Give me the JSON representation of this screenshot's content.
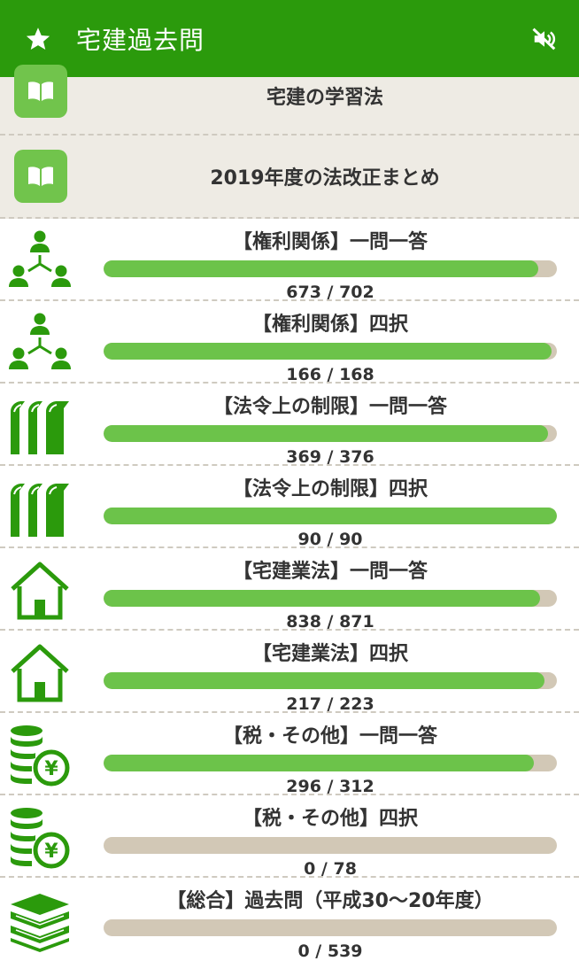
{
  "app": {
    "title": "宅建過去問"
  },
  "colors": {
    "primary": "#2b9a0c",
    "accent": "#6cc34a",
    "track": "#d2c8b6",
    "guide_bg": "#eeebe4"
  },
  "guides": [
    {
      "label": "宅建の学習法",
      "icon": "book-icon"
    },
    {
      "label": "2019年度の法改正まとめ",
      "icon": "book-icon"
    }
  ],
  "categories": [
    {
      "title": "【権利関係】一問一答",
      "progress": "673 / 702",
      "done": 673,
      "total": 702,
      "icon": "people-network-icon"
    },
    {
      "title": "【権利関係】四択",
      "progress": "166 / 168",
      "done": 166,
      "total": 168,
      "icon": "people-network-icon"
    },
    {
      "title": "【法令上の制限】一問一答",
      "progress": "369 / 376",
      "done": 369,
      "total": 376,
      "icon": "books-icon"
    },
    {
      "title": "【法令上の制限】四択",
      "progress": "90 / 90",
      "done": 90,
      "total": 90,
      "icon": "books-icon"
    },
    {
      "title": "【宅建業法】一問一答",
      "progress": "838 / 871",
      "done": 838,
      "total": 871,
      "icon": "house-icon"
    },
    {
      "title": "【宅建業法】四択",
      "progress": "217 / 223",
      "done": 217,
      "total": 223,
      "icon": "house-icon"
    },
    {
      "title": "【税・その他】一問一答",
      "progress": "296 / 312",
      "done": 296,
      "total": 312,
      "icon": "coins-yen-icon"
    },
    {
      "title": "【税・その他】四択",
      "progress": "0 / 78",
      "done": 0,
      "total": 78,
      "icon": "coins-yen-icon"
    },
    {
      "title": "【総合】過去問（平成30～20年度）",
      "progress": "0 / 539",
      "done": 0,
      "total": 539,
      "icon": "stacked-books-icon"
    }
  ]
}
